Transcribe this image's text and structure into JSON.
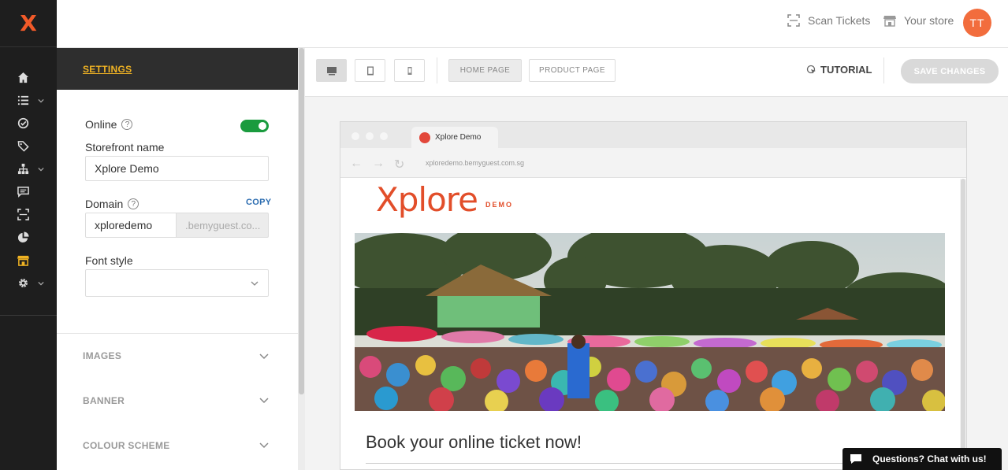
{
  "app": {
    "logo": "X"
  },
  "rail": {
    "items": [
      {
        "icon": "home-icon"
      },
      {
        "icon": "list-icon",
        "expand": true
      },
      {
        "icon": "check-circle-icon"
      },
      {
        "icon": "tag-icon"
      },
      {
        "icon": "sitemap-icon",
        "expand": true
      },
      {
        "icon": "chat-icon"
      },
      {
        "icon": "scan-icon"
      },
      {
        "icon": "pie-chart-icon"
      },
      {
        "icon": "store-icon",
        "active": true
      },
      {
        "icon": "gear-icon",
        "expand": true
      }
    ]
  },
  "topbar": {
    "scan_label": "Scan Tickets",
    "store_label": "Your store",
    "avatar_initials": "TT"
  },
  "settings": {
    "header": "SETTINGS",
    "online_label": "Online",
    "online": true,
    "storefront_label": "Storefront name",
    "storefront_value": "Xplore Demo",
    "domain_label": "Domain",
    "copy_label": "COPY",
    "domain_value": "xploredemo",
    "domain_suffix": ".bemyguest.co...",
    "font_label": "Font style",
    "font_value": "",
    "sections": [
      "IMAGES",
      "BANNER",
      "COLOUR SCHEME"
    ]
  },
  "toolbar": {
    "devices": [
      "desktop-icon",
      "tablet-icon",
      "mobile-icon"
    ],
    "active_device": "desktop-icon",
    "home_page": "HOME PAGE",
    "product_page": "PRODUCT PAGE",
    "tutorial": "TUTORIAL",
    "save": "SAVE CHANGES"
  },
  "preview": {
    "tab_title": "Xplore Demo",
    "url": "xploredemo.bemyguest.com.sg",
    "brand_name": "Xplore",
    "brand_sub": "DEMO",
    "headline": "Book your online ticket now!"
  },
  "chat": {
    "label": "Questions? Chat with us!"
  },
  "colors": {
    "accent": "#f15a29",
    "active_nav": "#f0b323",
    "toggle_on": "#1a9b3e"
  }
}
